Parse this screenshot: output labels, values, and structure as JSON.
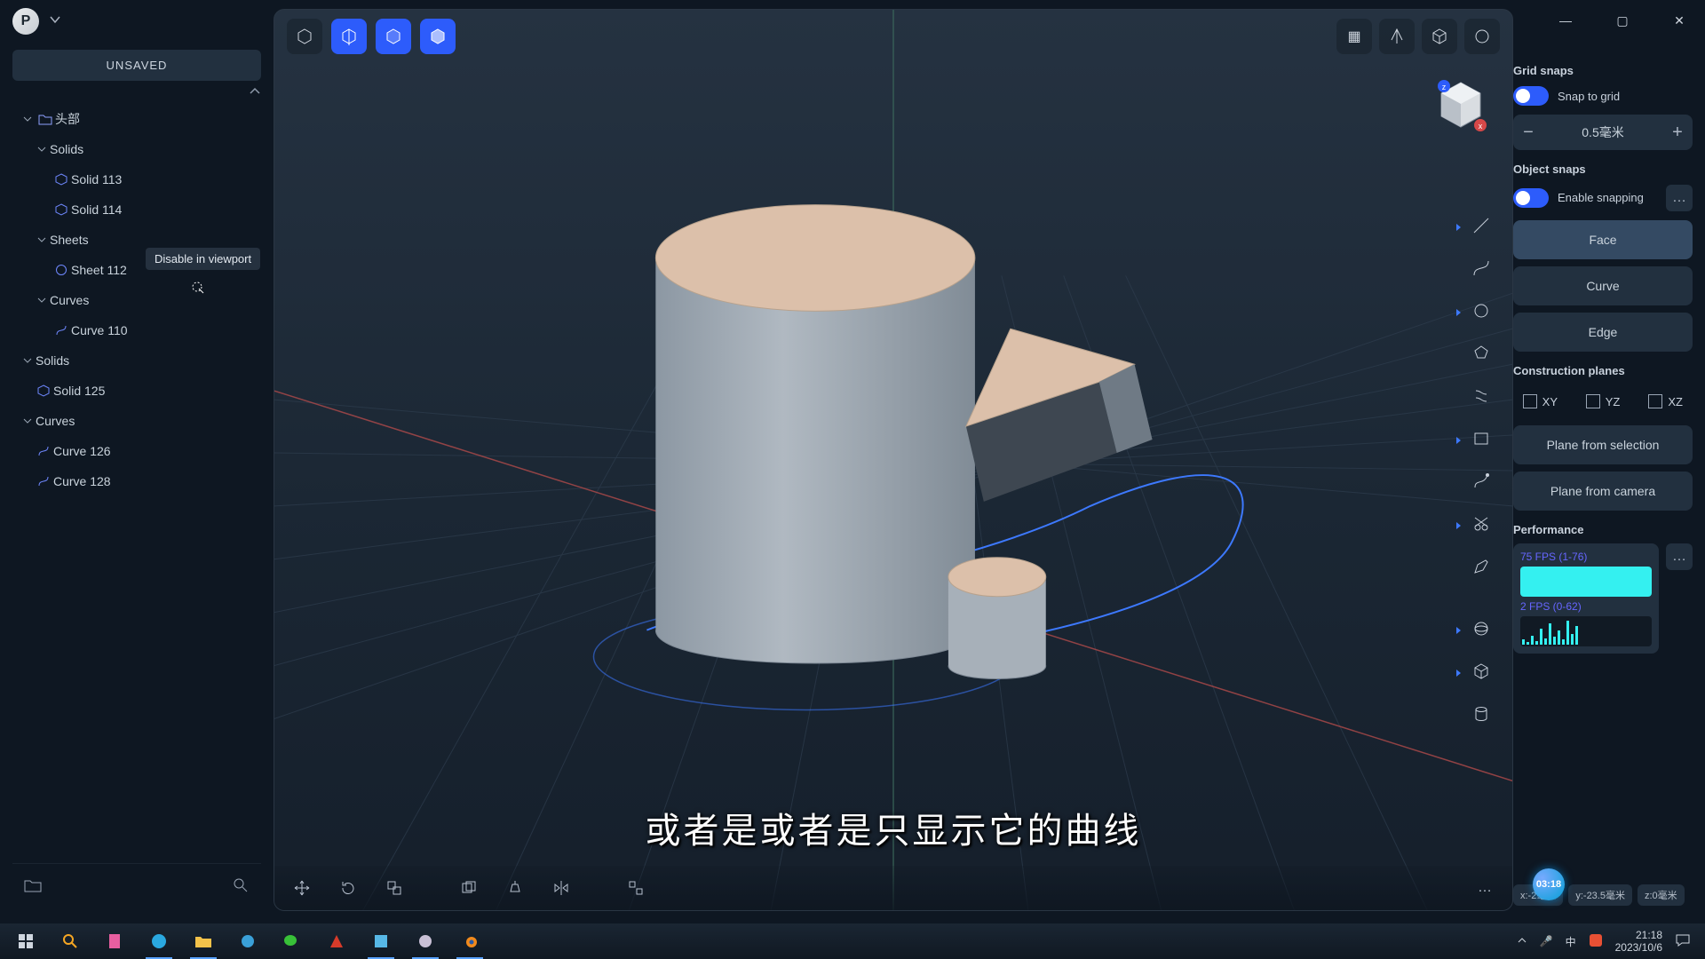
{
  "app": {
    "logo_letter": "P",
    "unsaved_label": "UNSAVED"
  },
  "tree": {
    "root": {
      "label": "头部"
    },
    "solids_group": "Solids",
    "solid_113": "Solid 113",
    "solid_114": "Solid 114",
    "sheets_group": "Sheets",
    "sheet_112": "Sheet 112",
    "curves_group": "Curves",
    "curve_110": "Curve 110",
    "solids2_group": "Solids",
    "solid_125": "Solid 125",
    "curves2_group": "Curves",
    "curve_126": "Curve 126",
    "curve_128": "Curve 128",
    "tooltip": "Disable in viewport"
  },
  "right": {
    "grid_snaps": "Grid snaps",
    "snap_to_grid": "Snap to grid",
    "grid_step": "0.5毫米",
    "object_snaps": "Object snaps",
    "enable_snapping": "Enable snapping",
    "face": "Face",
    "curve": "Curve",
    "edge": "Edge",
    "cplanes": "Construction planes",
    "xy": "XY",
    "yz": "YZ",
    "xz": "XZ",
    "plane_from_selection": "Plane from selection",
    "plane_from_camera": "Plane from camera",
    "performance": "Performance",
    "fps1": "75 FPS (1-76)",
    "fps2": "2 FPS (0-62)"
  },
  "footer": {
    "coord_x": "x:-2毫米",
    "coord_y": "y:-23.5毫米",
    "coord_z": "z:0毫米",
    "badge": "03:18"
  },
  "taskbar": {
    "time": "21:18",
    "date": "2023/10/6",
    "ime": "中"
  },
  "subtitle": "或者是或者是只显示它的曲线",
  "icons": {
    "search": "⌕",
    "folder": "🗀",
    "start": "⊞",
    "win_min": "—",
    "win_max": "▢",
    "win_close": "✕",
    "more": "…",
    "grid": "▦",
    "axes": "⋔",
    "cube": "⬡",
    "ring": "◯",
    "mic": "🎤",
    "notify": "💬"
  }
}
